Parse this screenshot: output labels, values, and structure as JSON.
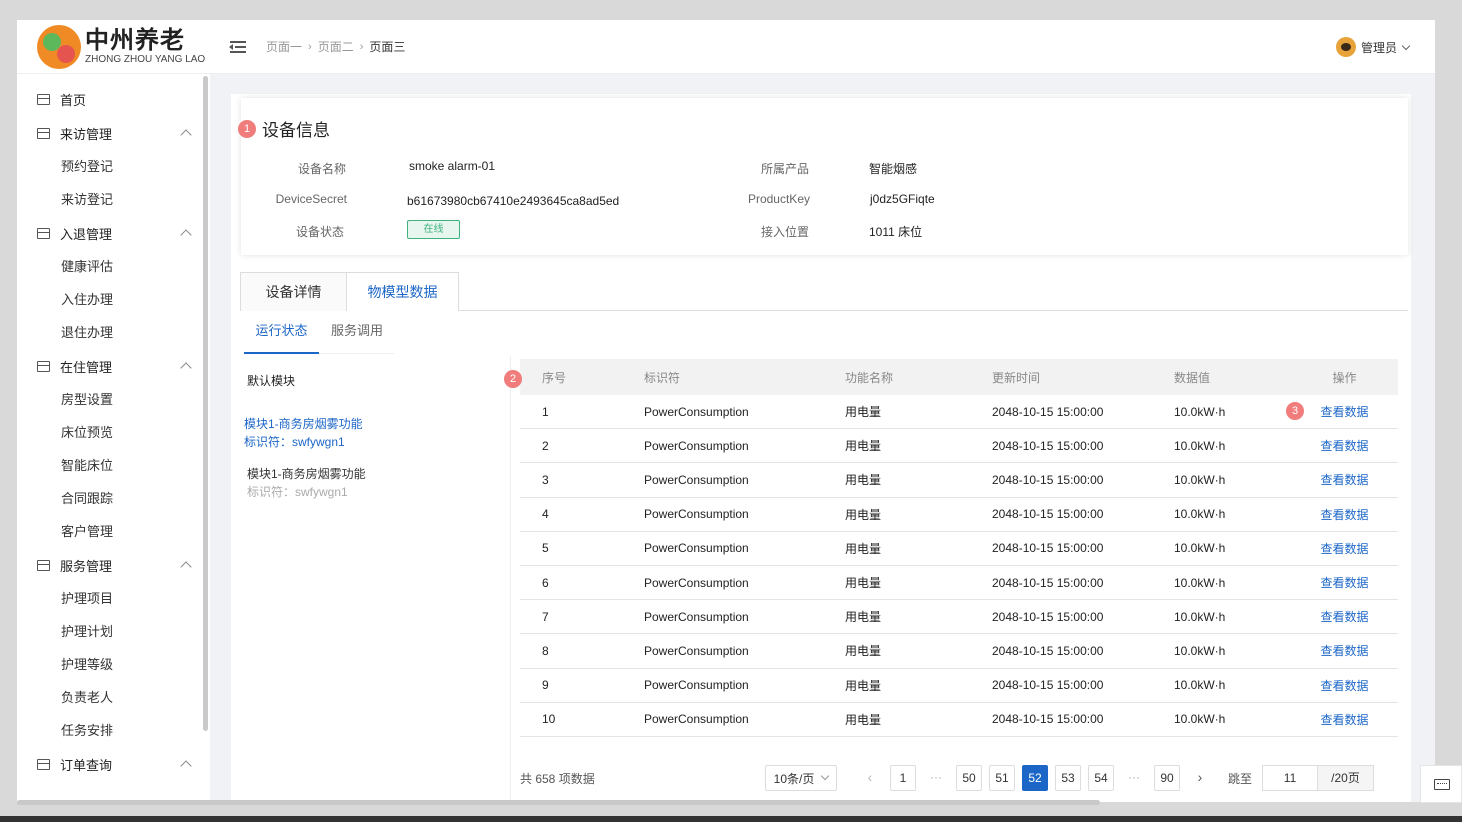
{
  "logo": {
    "cn": "中州养老",
    "en": "ZHONG ZHOU YANG LAO"
  },
  "sidebar": {
    "groups": [
      {
        "label": "首页",
        "children": []
      },
      {
        "label": "来访管理",
        "children": [
          "预约登记",
          "来访登记"
        ]
      },
      {
        "label": "入退管理",
        "children": [
          "健康评估",
          "入住办理",
          "退住办理"
        ]
      },
      {
        "label": "在住管理",
        "children": [
          "房型设置",
          "床位预览",
          "智能床位",
          "合同跟踪",
          "客户管理"
        ]
      },
      {
        "label": "服务管理",
        "children": [
          "护理项目",
          "护理计划",
          "护理等级",
          "负责老人",
          "任务安排"
        ]
      },
      {
        "label": "订单查询",
        "children": []
      }
    ]
  },
  "header": {
    "breadcrumb": [
      "页面一",
      "页面二",
      "页面三"
    ],
    "user": "管理员"
  },
  "device": {
    "title": "设备信息",
    "badge1": "1",
    "fields": {
      "name_label": "设备名称",
      "name": "smoke alarm-01",
      "product_label": "所属产品",
      "product": "智能烟感",
      "secret_label": "DeviceSecret",
      "secret": "b61673980cb67410e2493645ca8ad5ed",
      "key_label": "ProductKey",
      "key": "j0dz5GFiqte",
      "status_label": "设备状态",
      "status": "在线",
      "location_label": "接入位置",
      "location": "1011 床位"
    }
  },
  "tabs": [
    "设备详情",
    "物模型数据"
  ],
  "subtabs": [
    "运行状态",
    "服务调用"
  ],
  "modules": {
    "default": "默认模块",
    "items": [
      {
        "name": "模块1-商务房烟雾功能",
        "key": "标识符：swfywgn1"
      },
      {
        "name": "模块1-商务房烟雾功能",
        "key": "标识符：swfywgn1"
      }
    ]
  },
  "table": {
    "badge2": "2",
    "badge3": "3",
    "headers": [
      "序号",
      "标识符",
      "功能名称",
      "更新时间",
      "数据值",
      "操作"
    ],
    "rows": [
      [
        "1",
        "PowerConsumption",
        "用电量",
        "2048-10-15 15:00:00",
        "10.0kW·h",
        "查看数据"
      ],
      [
        "2",
        "PowerConsumption",
        "用电量",
        "2048-10-15 15:00:00",
        "10.0kW·h",
        "查看数据"
      ],
      [
        "3",
        "PowerConsumption",
        "用电量",
        "2048-10-15 15:00:00",
        "10.0kW·h",
        "查看数据"
      ],
      [
        "4",
        "PowerConsumption",
        "用电量",
        "2048-10-15 15:00:00",
        "10.0kW·h",
        "查看数据"
      ],
      [
        "5",
        "PowerConsumption",
        "用电量",
        "2048-10-15 15:00:00",
        "10.0kW·h",
        "查看数据"
      ],
      [
        "6",
        "PowerConsumption",
        "用电量",
        "2048-10-15 15:00:00",
        "10.0kW·h",
        "查看数据"
      ],
      [
        "7",
        "PowerConsumption",
        "用电量",
        "2048-10-15 15:00:00",
        "10.0kW·h",
        "查看数据"
      ],
      [
        "8",
        "PowerConsumption",
        "用电量",
        "2048-10-15 15:00:00",
        "10.0kW·h",
        "查看数据"
      ],
      [
        "9",
        "PowerConsumption",
        "用电量",
        "2048-10-15 15:00:00",
        "10.0kW·h",
        "查看数据"
      ],
      [
        "10",
        "PowerConsumption",
        "用电量",
        "2048-10-15 15:00:00",
        "10.0kW·h",
        "查看数据"
      ]
    ]
  },
  "pager": {
    "total": "共 658 项数据",
    "page_size": "10条/页",
    "prev": "‹",
    "next": "›",
    "ellipsis": "···",
    "pages": [
      "1",
      "50",
      "51",
      "52",
      "53",
      "54",
      "90"
    ],
    "current": "52",
    "jump_label": "跳至",
    "jump_value": "11",
    "jump_total": "/20页"
  }
}
